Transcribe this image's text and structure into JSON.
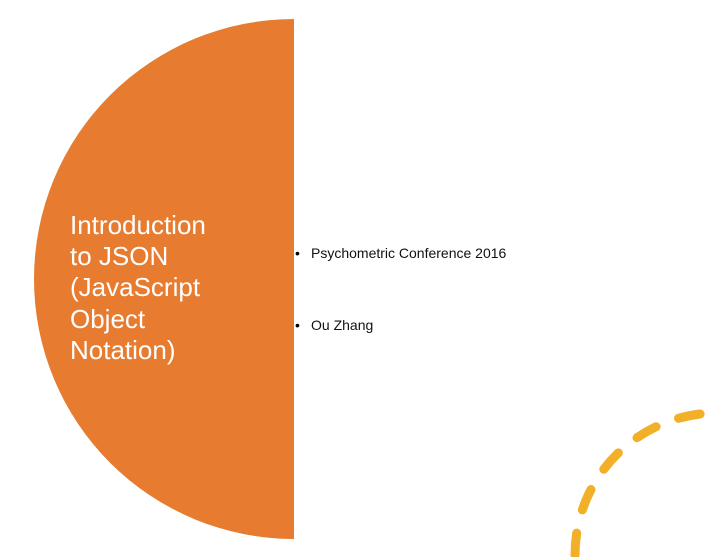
{
  "title": {
    "line1": "Introduction",
    "line2": "to JSON",
    "line3": "(JavaScript",
    "line4": "Object",
    "line5": "Notation)"
  },
  "bullets": {
    "item1": "Psychometric Conference 2016",
    "item2": "Ou Zhang"
  },
  "colors": {
    "accent_orange": "#e77c30",
    "accent_yellow": "#f2b029"
  }
}
